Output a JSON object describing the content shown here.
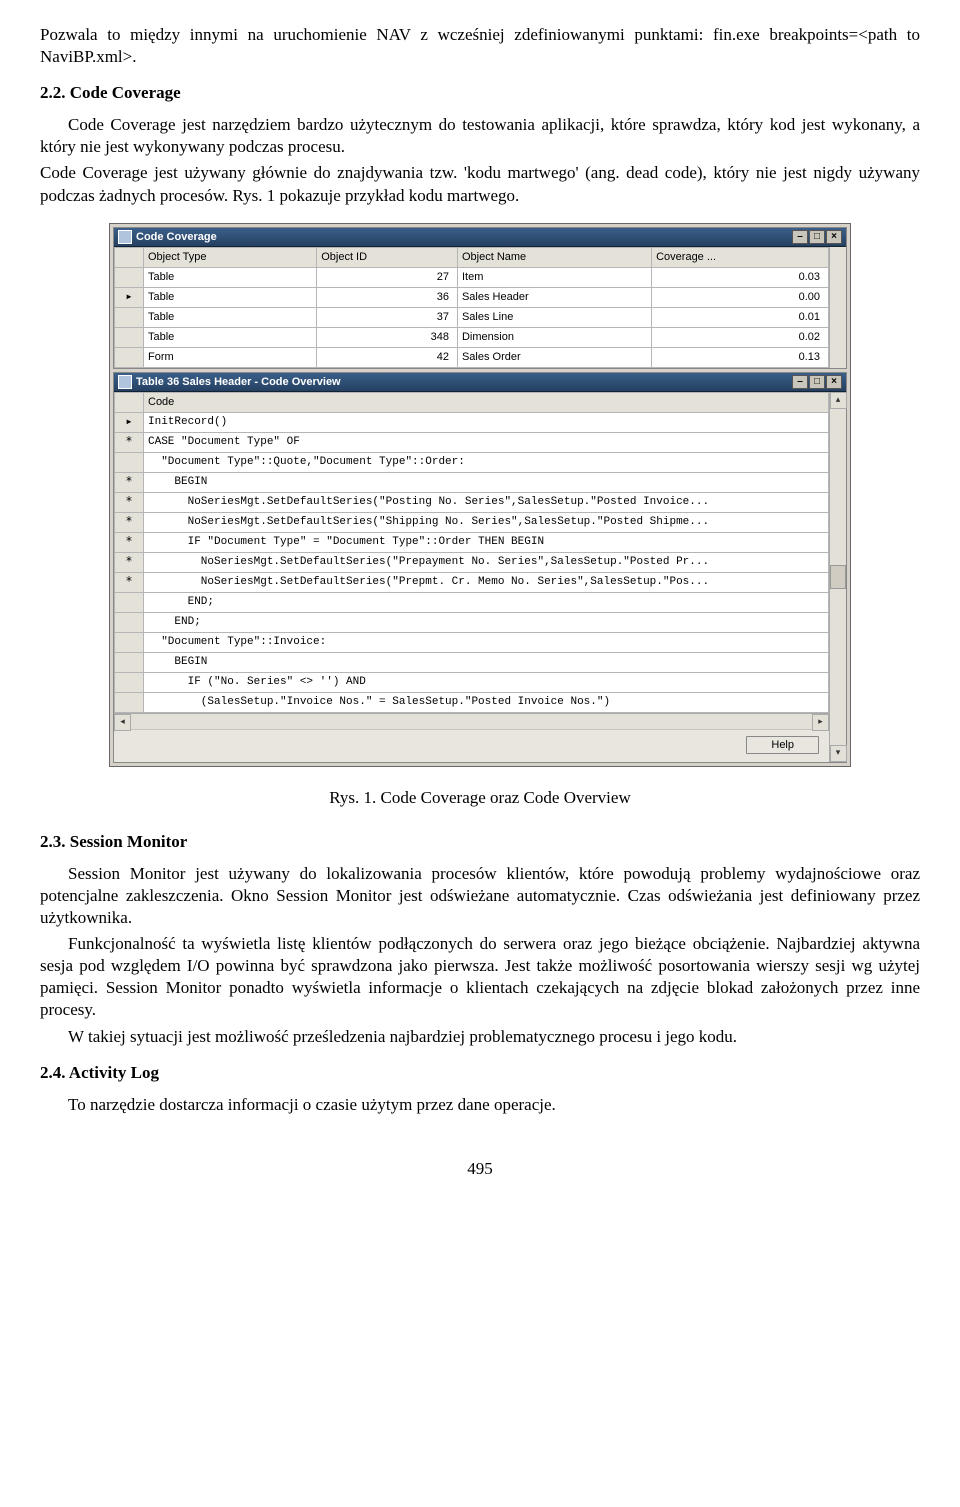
{
  "para1": "Pozwala to między innymi na uruchomienie NAV z wcześniej zdefiniowanymi punktami: fin.exe breakpoints=<path to NaviBP.xml>.",
  "sec22_title": "2.2. Code Coverage",
  "para22a": "Code Coverage jest narzędziem bardzo użytecznym do testowania aplikacji, które sprawdza, który kod jest wykonany, a który nie jest wykonywany podczas procesu.",
  "para22b": "Code Coverage jest używany głównie do znajdywania tzw. 'kodu martwego' (ang. dead code), który nie jest nigdy używany podczas żadnych procesów. Rys. 1 pokazuje przykład kodu martwego.",
  "figcaption": "Rys. 1. Code Coverage oraz Code Overview",
  "sec23_title": "2.3. Session Monitor",
  "para23a": "Session Monitor jest używany do lokalizowania procesów klientów, które powodują problemy wydajnościowe oraz potencjalne zakleszczenia. Okno Session Monitor jest odświeżane automatycznie. Czas odświeżania jest definiowany przez użytkownika.",
  "para23b": "Funkcjonalność ta wyświetla listę klientów podłączonych do serwera oraz jego bieżące obciążenie. Najbardziej aktywna sesja pod względem I/O powinna być sprawdzona jako pierwsza. Jest także możliwość posortowania wierszy sesji wg użytej pamięci. Session Monitor ponadto wyświetla informacje o klientach czekających na zdjęcie blokad założonych przez inne procesy.",
  "para23c": "W takiej sytuacji jest możliwość prześledzenia najbardziej problematycznego procesu i jego kodu.",
  "sec24_title": "2.4. Activity Log",
  "para24a": "To narzędzie dostarcza informacji o czasie użytym przez dane operacje.",
  "page_number": "495",
  "cc_win": {
    "title": "Code Coverage",
    "headers": [
      "",
      "Object Type",
      "Object ID",
      "Object Name",
      "Coverage ..."
    ],
    "rows": [
      {
        "marker": "",
        "type": "Table",
        "id": "27",
        "name": "Item",
        "cov": "0.03"
      },
      {
        "marker": "▸",
        "type": "Table",
        "id": "36",
        "name": "Sales Header",
        "cov": "0.00"
      },
      {
        "marker": "",
        "type": "Table",
        "id": "37",
        "name": "Sales Line",
        "cov": "0.01"
      },
      {
        "marker": "",
        "type": "Table",
        "id": "348",
        "name": "Dimension",
        "cov": "0.02"
      },
      {
        "marker": "",
        "type": "Form",
        "id": "42",
        "name": "Sales Order",
        "cov": "0.13"
      }
    ]
  },
  "co_win": {
    "title": "Table 36 Sales Header - Code Overview",
    "code_header": "Code",
    "help_button": "Help",
    "rows": [
      {
        "marker": "▸",
        "txt": "InitRecord()"
      },
      {
        "marker": "*",
        "txt": "CASE \"Document Type\" OF"
      },
      {
        "marker": "",
        "txt": "  \"Document Type\"::Quote,\"Document Type\"::Order:"
      },
      {
        "marker": "*",
        "txt": "    BEGIN"
      },
      {
        "marker": "*",
        "txt": "      NoSeriesMgt.SetDefaultSeries(\"Posting No. Series\",SalesSetup.\"Posted Invoice..."
      },
      {
        "marker": "*",
        "txt": "      NoSeriesMgt.SetDefaultSeries(\"Shipping No. Series\",SalesSetup.\"Posted Shipme..."
      },
      {
        "marker": "*",
        "txt": "      IF \"Document Type\" = \"Document Type\"::Order THEN BEGIN"
      },
      {
        "marker": "*",
        "txt": "        NoSeriesMgt.SetDefaultSeries(\"Prepayment No. Series\",SalesSetup.\"Posted Pr..."
      },
      {
        "marker": "*",
        "txt": "        NoSeriesMgt.SetDefaultSeries(\"Prepmt. Cr. Memo No. Series\",SalesSetup.\"Pos..."
      },
      {
        "marker": "",
        "txt": "      END;"
      },
      {
        "marker": "",
        "txt": "    END;"
      },
      {
        "marker": "",
        "txt": "  \"Document Type\"::Invoice:"
      },
      {
        "marker": "",
        "txt": "    BEGIN"
      },
      {
        "marker": "",
        "txt": "      IF (\"No. Series\" <> '') AND"
      },
      {
        "marker": "",
        "txt": "        (SalesSetup.\"Invoice Nos.\" = SalesSetup.\"Posted Invoice Nos.\")"
      }
    ]
  }
}
